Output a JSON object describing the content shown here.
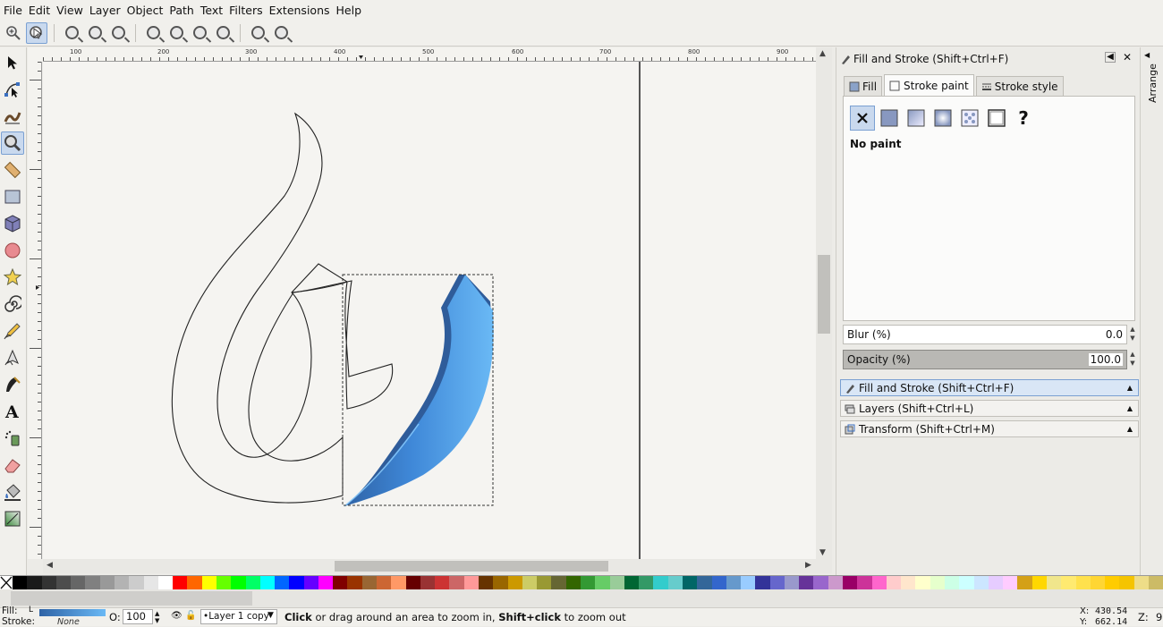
{
  "menu": [
    "File",
    "Edit",
    "View",
    "Layer",
    "Object",
    "Path",
    "Text",
    "Filters",
    "Extensions",
    "Help"
  ],
  "ruler": {
    "top_labels": [
      "100",
      "200",
      "300",
      "400",
      "500",
      "600",
      "700",
      "800",
      "900"
    ]
  },
  "dock": {
    "title": "Fill and Stroke (Shift+Ctrl+F)",
    "tabs": [
      "Fill",
      "Stroke paint",
      "Stroke style"
    ],
    "paint_modes": [
      "no-paint",
      "flat-color",
      "linear-gradient",
      "radial-gradient",
      "pattern",
      "swatch",
      "unset"
    ],
    "unset_label": "?",
    "paint_status": "No paint",
    "blur_label": "Blur (%)",
    "blur_value": "0.0",
    "opacity_label": "Opacity (%)",
    "opacity_value": "100.0",
    "sections": [
      "Fill and Stroke (Shift+Ctrl+F)",
      "Layers (Shift+Ctrl+L)",
      "Transform (Shift+Ctrl+M)"
    ],
    "arrange_label": "Arrange"
  },
  "status": {
    "fill_label": "Fill:",
    "stroke_label": "Stroke:",
    "fill_indicator": "L",
    "stroke_value": "None",
    "opacity_label": "O:",
    "opacity_value": "100",
    "layer_name": "•Layer 1 copy",
    "message_bold1": "Click",
    "message_part1": " or drag around an area to zoom in, ",
    "message_bold2": "Shift+click",
    "message_part2": " to zoom out",
    "x_label": "X:",
    "x_value": "430.54",
    "y_label": "Y:",
    "y_value": "662.14",
    "z_label": "Z:",
    "z_value": "9"
  },
  "colors": {
    "accent": "#7aa0d2",
    "shape_blue_light": "#5aaef2",
    "shape_blue_dark": "#2f63a6"
  },
  "palette": [
    "#000000",
    "#1a1a1a",
    "#333333",
    "#4d4d4d",
    "#666666",
    "#808080",
    "#999999",
    "#b3b3b3",
    "#cccccc",
    "#e6e6e6",
    "#ffffff",
    "#ff0000",
    "#ff6600",
    "#ffff00",
    "#66ff00",
    "#00ff00",
    "#00ff66",
    "#00ffff",
    "#0066ff",
    "#0000ff",
    "#6600ff",
    "#ff00ff",
    "#800000",
    "#993300",
    "#996633",
    "#cc6633",
    "#ff9966",
    "#660000",
    "#993333",
    "#cc3333",
    "#cc6666",
    "#ff9999",
    "#663300",
    "#996600",
    "#cc9900",
    "#cccc66",
    "#999933",
    "#666633",
    "#336600",
    "#339933",
    "#66cc66",
    "#99cc99",
    "#006633",
    "#339966",
    "#33cccc",
    "#66cccc",
    "#006666",
    "#336699",
    "#3366cc",
    "#6699cc",
    "#99ccff",
    "#333399",
    "#6666cc",
    "#9999cc",
    "#663399",
    "#9966cc",
    "#cc99cc",
    "#990066",
    "#cc3399",
    "#ff66cc",
    "#ffcccc",
    "#ffe6cc",
    "#ffffcc",
    "#e6ffcc",
    "#ccffe6",
    "#ccffff",
    "#cce6ff",
    "#e6ccff",
    "#ffccff",
    "#d4a017",
    "#ffd700",
    "#f0e68c",
    "#ffea70",
    "#ffe14d",
    "#ffd633",
    "#ffcc00",
    "#f5c400",
    "#eedd88",
    "#ccbb66"
  ]
}
